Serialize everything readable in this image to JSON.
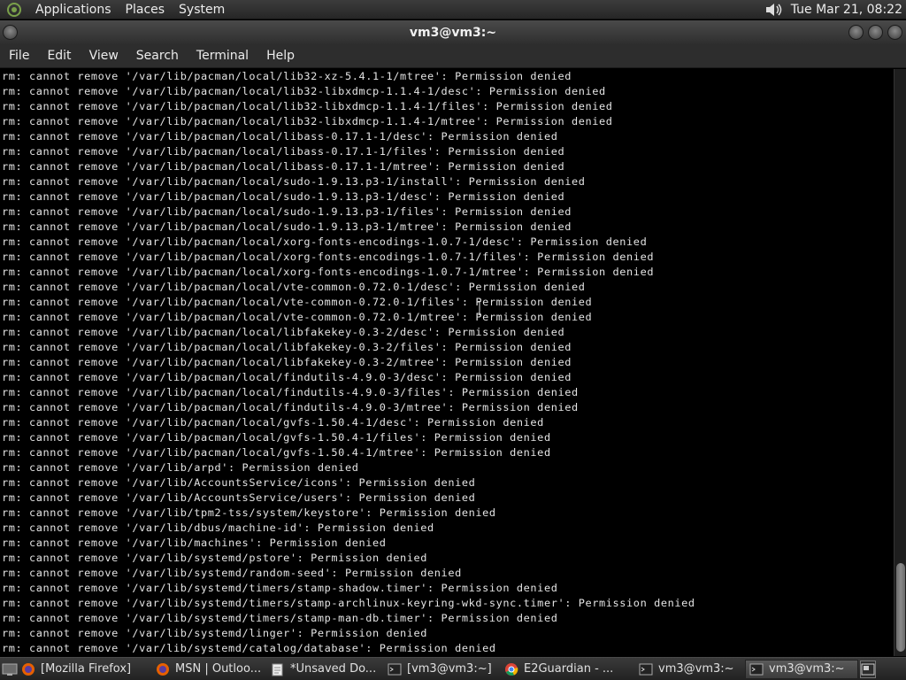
{
  "top_panel": {
    "menus": [
      "Applications",
      "Places",
      "System"
    ],
    "clock": "Tue Mar 21, 08:22",
    "icons": [
      "distro-logo-icon",
      "volume-icon"
    ]
  },
  "window": {
    "title": "vm3@vm3:~",
    "menu": [
      "File",
      "Edit",
      "View",
      "Search",
      "Terminal",
      "Help"
    ]
  },
  "terminal": {
    "lines": [
      "rm: cannot remove '/var/lib/pacman/local/lib32-xz-5.4.1-1/mtree': Permission denied",
      "rm: cannot remove '/var/lib/pacman/local/lib32-libxdmcp-1.1.4-1/desc': Permission denied",
      "rm: cannot remove '/var/lib/pacman/local/lib32-libxdmcp-1.1.4-1/files': Permission denied",
      "rm: cannot remove '/var/lib/pacman/local/lib32-libxdmcp-1.1.4-1/mtree': Permission denied",
      "rm: cannot remove '/var/lib/pacman/local/libass-0.17.1-1/desc': Permission denied",
      "rm: cannot remove '/var/lib/pacman/local/libass-0.17.1-1/files': Permission denied",
      "rm: cannot remove '/var/lib/pacman/local/libass-0.17.1-1/mtree': Permission denied",
      "rm: cannot remove '/var/lib/pacman/local/sudo-1.9.13.p3-1/install': Permission denied",
      "rm: cannot remove '/var/lib/pacman/local/sudo-1.9.13.p3-1/desc': Permission denied",
      "rm: cannot remove '/var/lib/pacman/local/sudo-1.9.13.p3-1/files': Permission denied",
      "rm: cannot remove '/var/lib/pacman/local/sudo-1.9.13.p3-1/mtree': Permission denied",
      "rm: cannot remove '/var/lib/pacman/local/xorg-fonts-encodings-1.0.7-1/desc': Permission denied",
      "rm: cannot remove '/var/lib/pacman/local/xorg-fonts-encodings-1.0.7-1/files': Permission denied",
      "rm: cannot remove '/var/lib/pacman/local/xorg-fonts-encodings-1.0.7-1/mtree': Permission denied",
      "rm: cannot remove '/var/lib/pacman/local/vte-common-0.72.0-1/desc': Permission denied",
      "rm: cannot remove '/var/lib/pacman/local/vte-common-0.72.0-1/files': Permission denied",
      "rm: cannot remove '/var/lib/pacman/local/vte-common-0.72.0-1/mtree': Permission denied",
      "rm: cannot remove '/var/lib/pacman/local/libfakekey-0.3-2/desc': Permission denied",
      "rm: cannot remove '/var/lib/pacman/local/libfakekey-0.3-2/files': Permission denied",
      "rm: cannot remove '/var/lib/pacman/local/libfakekey-0.3-2/mtree': Permission denied",
      "rm: cannot remove '/var/lib/pacman/local/findutils-4.9.0-3/desc': Permission denied",
      "rm: cannot remove '/var/lib/pacman/local/findutils-4.9.0-3/files': Permission denied",
      "rm: cannot remove '/var/lib/pacman/local/findutils-4.9.0-3/mtree': Permission denied",
      "rm: cannot remove '/var/lib/pacman/local/gvfs-1.50.4-1/desc': Permission denied",
      "rm: cannot remove '/var/lib/pacman/local/gvfs-1.50.4-1/files': Permission denied",
      "rm: cannot remove '/var/lib/pacman/local/gvfs-1.50.4-1/mtree': Permission denied",
      "rm: cannot remove '/var/lib/arpd': Permission denied",
      "rm: cannot remove '/var/lib/AccountsService/icons': Permission denied",
      "rm: cannot remove '/var/lib/AccountsService/users': Permission denied",
      "rm: cannot remove '/var/lib/tpm2-tss/system/keystore': Permission denied",
      "rm: cannot remove '/var/lib/dbus/machine-id': Permission denied",
      "rm: cannot remove '/var/lib/machines': Permission denied",
      "rm: cannot remove '/var/lib/systemd/pstore': Permission denied",
      "rm: cannot remove '/var/lib/systemd/random-seed': Permission denied",
      "rm: cannot remove '/var/lib/systemd/timers/stamp-shadow.timer': Permission denied",
      "rm: cannot remove '/var/lib/systemd/timers/stamp-archlinux-keyring-wkd-sync.timer': Permission denied",
      "rm: cannot remove '/var/lib/systemd/timers/stamp-man-db.timer': Permission denied",
      "rm: cannot remove '/var/lib/systemd/linger': Permission denied",
      "rm: cannot remove '/var/lib/systemd/catalog/database': Permission denied"
    ]
  },
  "taskbar": {
    "tasks": [
      {
        "label": "[Mozilla Firefox]",
        "icon": "firefox-icon",
        "active": false
      },
      {
        "label": "MSN | Outloo...",
        "icon": "firefox-icon",
        "active": false
      },
      {
        "label": "*Unsaved Do...",
        "icon": "text-editor-icon",
        "active": false
      },
      {
        "label": "[vm3@vm3:~]",
        "icon": "terminal-icon",
        "active": false
      },
      {
        "label": "E2Guardian - ...",
        "icon": "chrome-icon",
        "active": false
      },
      {
        "label": "vm3@vm3:~",
        "icon": "terminal-icon",
        "active": false
      },
      {
        "label": "vm3@vm3:~",
        "icon": "terminal-icon",
        "active": true
      }
    ]
  },
  "colors": {
    "terminal_bg": "#000000",
    "terminal_fg": "#e4e4e4",
    "panel_bg": "#2d2d2d"
  }
}
